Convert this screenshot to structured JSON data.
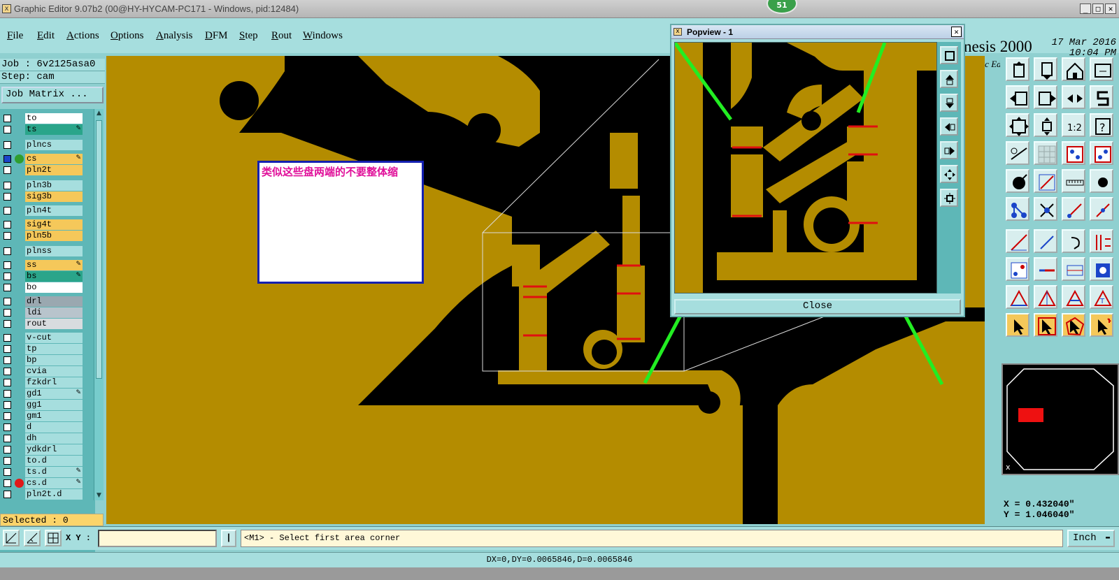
{
  "window": {
    "title": "Graphic Editor 9.07b2 (00@HY-HYCAM-PC171 - Windows, pid:12484)",
    "badge": "51",
    "controls": [
      "_",
      "□",
      "✕"
    ]
  },
  "menu": [
    {
      "label": "File"
    },
    {
      "label": "Edit"
    },
    {
      "label": "Actions"
    },
    {
      "label": "Options"
    },
    {
      "label": "Analysis"
    },
    {
      "label": "DFM"
    },
    {
      "label": "Step"
    },
    {
      "label": "Rout"
    },
    {
      "label": "Windows"
    }
  ],
  "brand": {
    "name": "nesis 2000",
    "subtitle": "raphic Editor",
    "date": "17 Mar 2016",
    "time": "10:04 PM"
  },
  "job": {
    "job_line": "Job : 6v2125asa0",
    "step_line": "Step: cam",
    "matrix_button": "Job Matrix ..."
  },
  "layers": [
    {
      "name": "to",
      "bg": "#ffffff",
      "dot": "",
      "hand": false,
      "selected": false
    },
    {
      "name": "ts",
      "bg": "#2aa58a",
      "dot": "",
      "hand": true,
      "selected": false
    },
    {
      "name": "plncs",
      "bg": "#a6dede",
      "dot": "",
      "hand": false,
      "selected": false
    },
    {
      "name": "cs",
      "bg": "#f5c85a",
      "dot": "#2f9e2f",
      "hand": true,
      "selected": true
    },
    {
      "name": "pln2t",
      "bg": "#f5c85a",
      "dot": "",
      "hand": false,
      "selected": false
    },
    {
      "name": "pln3b",
      "bg": "#a6dede",
      "dot": "",
      "hand": false,
      "selected": false
    },
    {
      "name": "sig3b",
      "bg": "#f5c85a",
      "dot": "",
      "hand": false,
      "selected": false
    },
    {
      "name": "pln4t",
      "bg": "#a6dede",
      "dot": "",
      "hand": false,
      "selected": false
    },
    {
      "name": "sig4t",
      "bg": "#f5c85a",
      "dot": "",
      "hand": false,
      "selected": false
    },
    {
      "name": "pln5b",
      "bg": "#f5c85a",
      "dot": "",
      "hand": false,
      "selected": false
    },
    {
      "name": "plnss",
      "bg": "#a6dede",
      "dot": "",
      "hand": false,
      "selected": false
    },
    {
      "name": "ss",
      "bg": "#f5c85a",
      "dot": "",
      "hand": true,
      "selected": false
    },
    {
      "name": "bs",
      "bg": "#2aa58a",
      "dot": "",
      "hand": true,
      "selected": false
    },
    {
      "name": "bo",
      "bg": "#ffffff",
      "dot": "",
      "hand": false,
      "selected": false
    },
    {
      "name": "drl",
      "bg": "#9aa8b0",
      "dot": "",
      "hand": false,
      "selected": false
    },
    {
      "name": "ldi",
      "bg": "#b8c4cc",
      "dot": "",
      "hand": false,
      "selected": false
    },
    {
      "name": "rout",
      "bg": "#d8dcdf",
      "dot": "",
      "hand": false,
      "selected": false
    },
    {
      "name": "v-cut",
      "bg": "#a6dede",
      "dot": "",
      "hand": false,
      "selected": false
    },
    {
      "name": "tp",
      "bg": "#a6dede",
      "dot": "",
      "hand": false,
      "selected": false
    },
    {
      "name": "bp",
      "bg": "#a6dede",
      "dot": "",
      "hand": false,
      "selected": false
    },
    {
      "name": "cvia",
      "bg": "#a6dede",
      "dot": "",
      "hand": false,
      "selected": false
    },
    {
      "name": "fzkdrl",
      "bg": "#a6dede",
      "dot": "",
      "hand": false,
      "selected": false
    },
    {
      "name": "gd1",
      "bg": "#a6dede",
      "dot": "",
      "hand": true,
      "selected": false
    },
    {
      "name": "gg1",
      "bg": "#a6dede",
      "dot": "",
      "hand": false,
      "selected": false
    },
    {
      "name": "gm1",
      "bg": "#a6dede",
      "dot": "",
      "hand": false,
      "selected": false
    },
    {
      "name": "d",
      "bg": "#a6dede",
      "dot": "",
      "hand": false,
      "selected": false
    },
    {
      "name": "dh",
      "bg": "#a6dede",
      "dot": "",
      "hand": false,
      "selected": false
    },
    {
      "name": "ydkdrl",
      "bg": "#a6dede",
      "dot": "",
      "hand": false,
      "selected": false
    },
    {
      "name": "to.d",
      "bg": "#a6dede",
      "dot": "",
      "hand": false,
      "selected": false
    },
    {
      "name": "ts.d",
      "bg": "#a6dede",
      "dot": "",
      "hand": true,
      "selected": false
    },
    {
      "name": "cs.d",
      "bg": "#a6dede",
      "dot": "#e01818",
      "hand": true,
      "selected": false
    },
    {
      "name": "pln2t.d",
      "bg": "#a6dede",
      "dot": "",
      "hand": false,
      "selected": false
    }
  ],
  "selected_label": "Selected : 0",
  "annotation": {
    "text": "类似这些盘两端的不要整体缩"
  },
  "popview": {
    "title": "Popview - 1",
    "close_label": "Close"
  },
  "cursor": {
    "x_text": "X = 0.432040\"",
    "y_text": "Y = 1.046040\""
  },
  "command": {
    "xy_label": "X Y :",
    "xy_value": "",
    "pipe_label": "|",
    "prompt": "<M1> - Select first area corner",
    "units": "Inch"
  },
  "status": {
    "delta": "DX=0,DY=0.0065846,D=0.0065846"
  },
  "colors": {
    "copper": "#b48c00",
    "background": "#000000",
    "highlight": "#e01010",
    "arrow": "#22ee22"
  },
  "tool_icons": [
    "move-up-icon",
    "move-down-icon",
    "home-icon",
    "pan-icon",
    "shift-left-icon",
    "shift-right-icon",
    "split-icon",
    "s-curve-icon",
    "fit-icon",
    "center-icon",
    "ratio-icon",
    "help-icon",
    "measure-icon",
    "grid-icon",
    "layer-set-a-icon",
    "layer-set-b-icon",
    "snap-icon",
    "angle-icon",
    "ruler-icon",
    "point-icon",
    "connect-icon",
    "cross-icon",
    "vector-icon",
    "node-icon",
    "edit-line-icon",
    "slash-icon",
    "rotate-icon",
    "fence-icon",
    "copy-icon",
    "segment-icon",
    "align-icon",
    "group-icon",
    "triangle-icon",
    "arc-tri-icon",
    "shape-tri-icon",
    "text-tri-icon",
    "select-icon",
    "select-box-icon",
    "select-poly-icon",
    "select-more-icon"
  ]
}
